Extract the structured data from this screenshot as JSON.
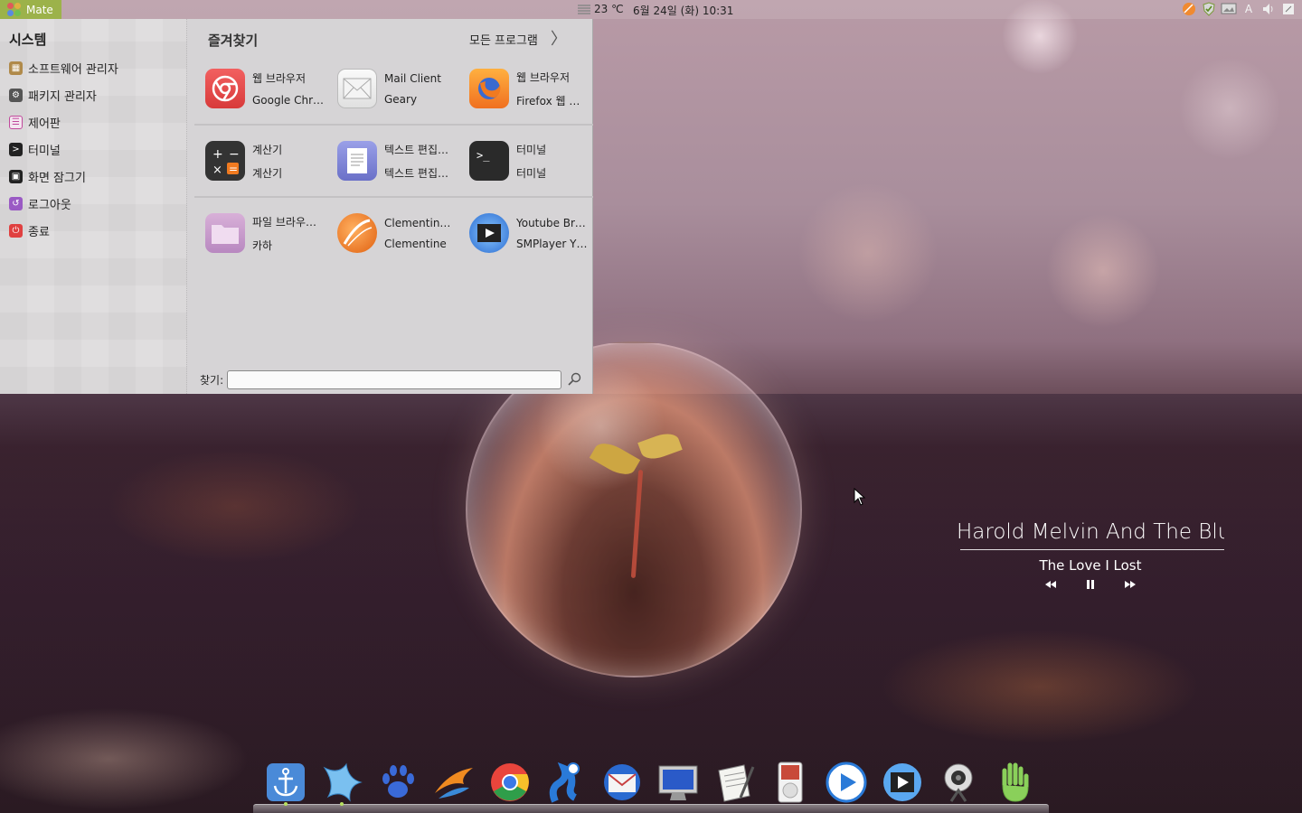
{
  "top_panel": {
    "menu_label": "Mate",
    "weather": "23 ℃",
    "clock": "6월 24일 (화) 10:31",
    "tray_icons": [
      "clementine-icon",
      "shield-icon",
      "display-icon",
      "keyboard-layout-icon",
      "volume-icon",
      "window-list-icon"
    ],
    "keyboard_label": "A"
  },
  "menu": {
    "system": {
      "title": "시스템",
      "items": [
        {
          "label": "소프트웨어 관리자",
          "icon": "software-manager-icon",
          "color": "#b08a4a"
        },
        {
          "label": "패키지 관리자",
          "icon": "package-manager-icon",
          "color": "#555555"
        },
        {
          "label": "제어판",
          "icon": "control-panel-icon",
          "color": "#c04a9c"
        },
        {
          "label": "터미널",
          "icon": "terminal-icon",
          "color": "#222222"
        },
        {
          "label": "화면 잠그기",
          "icon": "lock-icon",
          "color": "#222222"
        },
        {
          "label": "로그아웃",
          "icon": "logout-icon",
          "color": "#9a5ac4"
        },
        {
          "label": "종료",
          "icon": "power-icon",
          "color": "#e04040"
        }
      ]
    },
    "favorites": {
      "title": "즐겨찾기",
      "all_programs": "모든 프로그램",
      "apps": [
        {
          "name": "웹 브라우저",
          "desc": "Google Chr…",
          "icon": "chrome-icon"
        },
        {
          "name": "Mail Client",
          "desc": "Geary",
          "icon": "mail-icon"
        },
        {
          "name": "웹 브라우저",
          "desc": "Firefox 웹 …",
          "icon": "firefox-icon"
        },
        {
          "name": "계산기",
          "desc": "계산기",
          "icon": "calculator-icon"
        },
        {
          "name": "텍스트 편집…",
          "desc": "텍스트 편집…",
          "icon": "text-editor-icon"
        },
        {
          "name": "터미널",
          "desc": "터미널",
          "icon": "terminal-app-icon"
        },
        {
          "name": "파일 브라우…",
          "desc": "카하",
          "icon": "folder-icon"
        },
        {
          "name": "Clementine …",
          "desc": "Clementine",
          "icon": "clementine-app-icon"
        },
        {
          "name": "Youtube Bro…",
          "desc": "SMPlayer Y…",
          "icon": "smplayer-icon"
        }
      ]
    },
    "search": {
      "label": "찾기:",
      "value": "",
      "placeholder": ""
    }
  },
  "music_widget": {
    "artist": "Harold Melvin And The Blue Notes",
    "title": "The Love I Lost"
  },
  "dock": {
    "items": [
      "anchor-icon",
      "starfish-icon",
      "paw-icon",
      "swift-icon",
      "chrome-icon",
      "gimp-icon",
      "thunderbird-icon",
      "monitor-icon",
      "notepad-icon",
      "ipod-icon",
      "media-player-icon",
      "smplayer-icon",
      "webcam-icon",
      "hand-icon"
    ]
  },
  "colors": {
    "menu_accent": "#9cb24a",
    "menu_bg": "#d6d4d6"
  }
}
